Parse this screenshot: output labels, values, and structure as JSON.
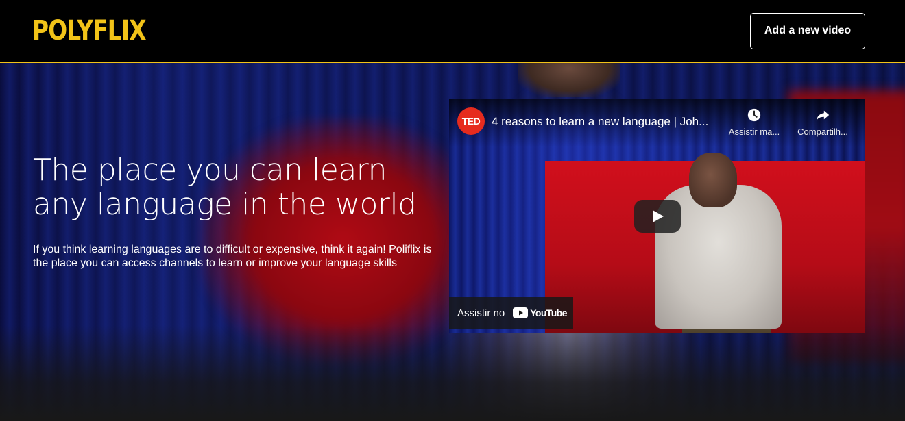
{
  "header": {
    "logo_text": "POLYFLIX",
    "add_button_label": "Add a new video",
    "accent_color": "#f2c318"
  },
  "hero": {
    "headline": "The place you can learn any language in the world",
    "description": "If you think learning languages are to difficult or expensive, think it again! Poliflix is the place you can access channels to learn or improve your language skills"
  },
  "video": {
    "channel_logo_text": "TED",
    "title": "4 reasons to learn a new language | Joh...",
    "watch_later_label": "Assistir ma...",
    "share_label": "Compartilh...",
    "watch_on_label": "Assistir no",
    "youtube_word": "YouTube",
    "icons": {
      "watch_later": "clock-icon",
      "share": "share-arrow-icon",
      "play": "play-icon"
    }
  }
}
